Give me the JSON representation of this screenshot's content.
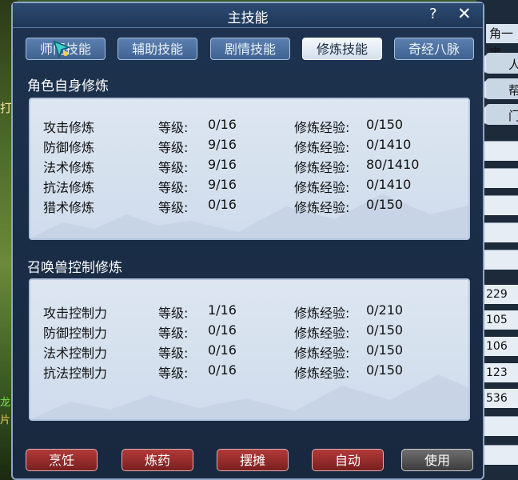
{
  "background": {
    "left_text_1": "打",
    "left_text_2": "龙",
    "left_text_3": "片",
    "right_title": "角一宝",
    "right_chips": [
      "人",
      "帮",
      "门"
    ],
    "right_numbers": [
      "229",
      "105",
      "106",
      "123",
      "536"
    ]
  },
  "window": {
    "title": "主技能",
    "help_label": "?",
    "close_label": "✕"
  },
  "tabs": [
    {
      "label": "师门技能",
      "active": false
    },
    {
      "label": "辅助技能",
      "active": false
    },
    {
      "label": "剧情技能",
      "active": false
    },
    {
      "label": "修炼技能",
      "active": true
    },
    {
      "label": "奇经八脉",
      "active": false
    }
  ],
  "self_cultivation": {
    "title": "角色自身修炼",
    "level_label": "等级:",
    "exp_label": "修炼经验:",
    "rows": [
      {
        "name": "攻击修炼",
        "level": "0/16",
        "exp": "0/150"
      },
      {
        "name": "防御修炼",
        "level": "9/16",
        "exp": "0/1410"
      },
      {
        "name": "法术修炼",
        "level": "9/16",
        "exp": "80/1410"
      },
      {
        "name": "抗法修炼",
        "level": "9/16",
        "exp": "0/1410"
      },
      {
        "name": "猎术修炼",
        "level": "0/16",
        "exp": "0/150"
      }
    ]
  },
  "pet_cultivation": {
    "title": "召唤兽控制修炼",
    "level_label": "等级:",
    "exp_label": "修炼经验:",
    "rows": [
      {
        "name": "攻击控制力",
        "level": "1/16",
        "exp": "0/210"
      },
      {
        "name": "防御控制力",
        "level": "0/16",
        "exp": "0/150"
      },
      {
        "name": "法术控制力",
        "level": "0/16",
        "exp": "0/150"
      },
      {
        "name": "抗法控制力",
        "level": "0/16",
        "exp": "0/150"
      }
    ]
  },
  "bottom_buttons": [
    {
      "label": "烹饪"
    },
    {
      "label": "炼药"
    },
    {
      "label": "摆摊"
    },
    {
      "label": "自动"
    },
    {
      "label": "使用"
    }
  ],
  "colors": {
    "accent_red": "#9a2a2a",
    "panel": "#d6e1ee",
    "window": "#1c2f4b"
  }
}
